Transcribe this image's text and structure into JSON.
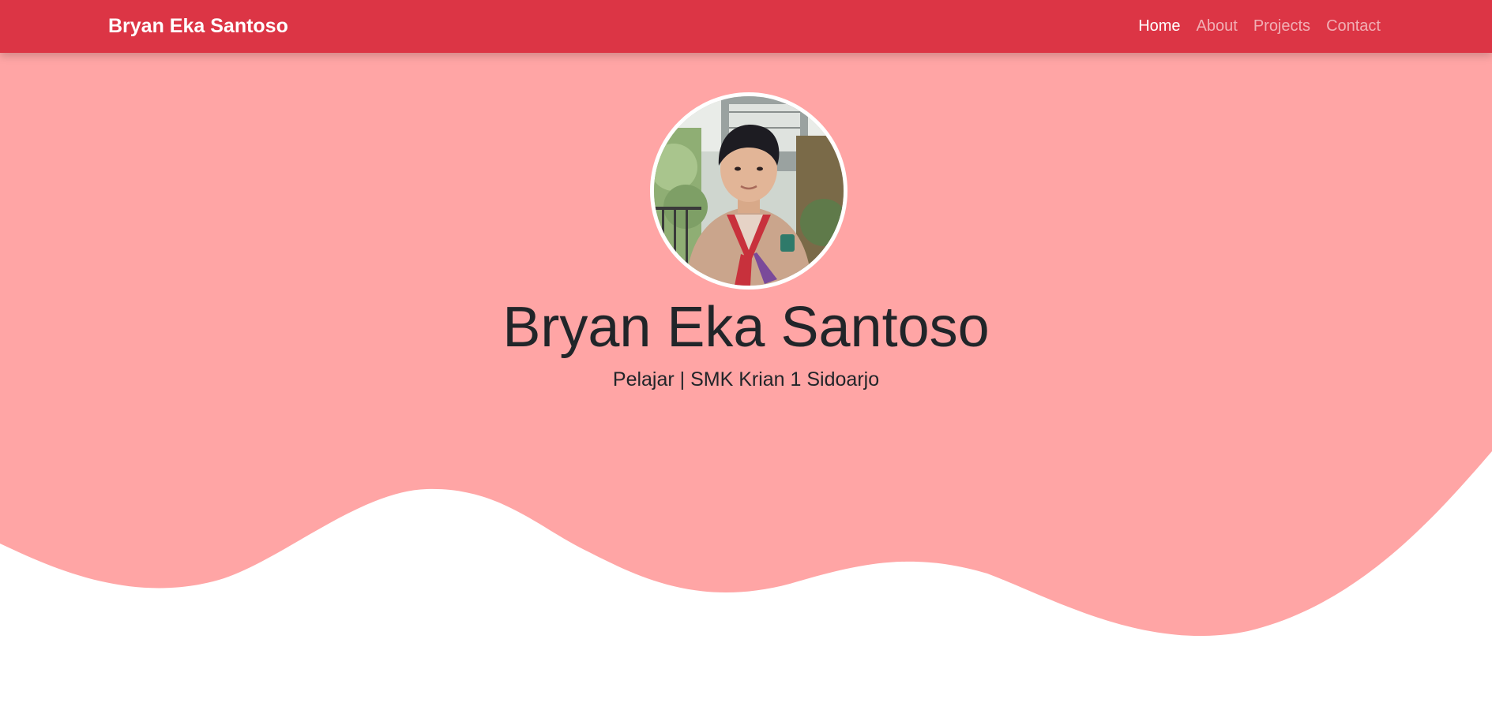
{
  "navbar": {
    "brand": "Bryan Eka Santoso",
    "links": [
      {
        "label": "Home",
        "active": true
      },
      {
        "label": "About",
        "active": false
      },
      {
        "label": "Projects",
        "active": false
      },
      {
        "label": "Contact",
        "active": false
      }
    ]
  },
  "hero": {
    "name": "Bryan Eka Santoso",
    "subtitle": "Pelajar | SMK Krian 1 Sidoarjo"
  },
  "colors": {
    "navbar_bg": "#dc3545",
    "hero_bg": "#ffa5a5",
    "text_dark": "#212529",
    "page_bg": "#ffffff"
  }
}
